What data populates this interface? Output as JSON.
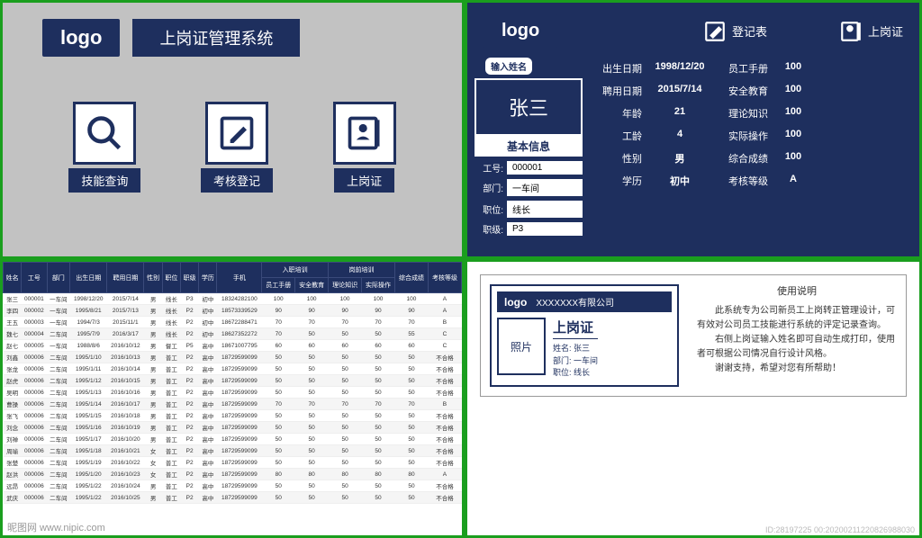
{
  "logo_text": "logo",
  "system_title": "上岗证管理系统",
  "menu": {
    "skill_query": "技能查询",
    "assess_register": "考核登记",
    "cert": "上岗证"
  },
  "detail": {
    "input_name_label": "输入姓名",
    "name": "张三",
    "basic_info": "基本信息",
    "fields": {
      "emp_no_label": "工号:",
      "emp_no": "000001",
      "dept_label": "部门:",
      "dept": "一车间",
      "pos_label": "职位:",
      "pos": "线长",
      "grade_label": "职级:",
      "grade": "P3"
    },
    "tabs": {
      "register": "登记表",
      "cert": "上岗证"
    },
    "info": {
      "birth_label": "出生日期",
      "birth": "1998/12/20",
      "hire_label": "聘用日期",
      "hire": "2015/7/14",
      "age_label": "年龄",
      "age": "21",
      "seniority_label": "工龄",
      "seniority": "4",
      "gender_label": "性别",
      "gender": "男",
      "edu_label": "学历",
      "edu": "初中",
      "handbook_label": "员工手册",
      "handbook": "100",
      "safety_label": "安全教育",
      "safety": "100",
      "theory_label": "理论知识",
      "theory": "100",
      "practice_label": "实际操作",
      "practice": "100",
      "total_label": "综合成绩",
      "total": "100",
      "level_label": "考核等级",
      "level": "A"
    }
  },
  "table": {
    "headers": [
      "姓名",
      "工号",
      "部门",
      "出生日期",
      "聘用日期",
      "性别",
      "职位",
      "职级",
      "学历",
      "手机",
      "员工手册",
      "安全教育",
      "理论知识",
      "实际操作",
      "综合成绩",
      "考核等级"
    ],
    "header_group_left": "入职培训",
    "header_group_right": "岗前培训",
    "rows": [
      [
        "张三",
        "000001",
        "一车间",
        "1998/12/20",
        "2015/7/14",
        "男",
        "线长",
        "P3",
        "初中",
        "18324282100",
        "100",
        "100",
        "100",
        "100",
        "100",
        "A"
      ],
      [
        "李四",
        "000002",
        "一车间",
        "1995/8/21",
        "2015/7/13",
        "男",
        "线长",
        "P2",
        "初中",
        "18573339529",
        "90",
        "90",
        "90",
        "90",
        "90",
        "A"
      ],
      [
        "王五",
        "000003",
        "一车间",
        "1994/7/3",
        "2015/11/1",
        "男",
        "线长",
        "P2",
        "初中",
        "18672288471",
        "70",
        "70",
        "70",
        "70",
        "70",
        "B"
      ],
      [
        "魏七",
        "000004",
        "二车间",
        "1995/7/9",
        "2016/3/17",
        "男",
        "线长",
        "P2",
        "初中",
        "18627352272",
        "70",
        "50",
        "50",
        "50",
        "55",
        "C"
      ],
      [
        "赵七",
        "000005",
        "一车间",
        "1988/8/6",
        "2016/10/12",
        "男",
        "督工",
        "P5",
        "高中",
        "18671007795",
        "60",
        "60",
        "60",
        "60",
        "60",
        "C"
      ],
      [
        "刘鑫",
        "000006",
        "二车间",
        "1995/1/10",
        "2016/10/13",
        "男",
        "普工",
        "P2",
        "高中",
        "18729599099",
        "50",
        "50",
        "50",
        "50",
        "50",
        "不合格"
      ],
      [
        "张龙",
        "000006",
        "二车间",
        "1995/1/11",
        "2016/10/14",
        "男",
        "普工",
        "P2",
        "高中",
        "18729599099",
        "50",
        "50",
        "50",
        "50",
        "50",
        "不合格"
      ],
      [
        "赵虎",
        "000006",
        "二车间",
        "1995/1/12",
        "2016/10/15",
        "男",
        "普工",
        "P2",
        "高中",
        "18729599099",
        "50",
        "50",
        "50",
        "50",
        "50",
        "不合格"
      ],
      [
        "吴明",
        "000006",
        "二车间",
        "1995/1/13",
        "2016/10/16",
        "男",
        "普工",
        "P2",
        "高中",
        "18729599099",
        "50",
        "50",
        "50",
        "50",
        "50",
        "不合格"
      ],
      [
        "曹操",
        "000006",
        "二车间",
        "1995/1/14",
        "2016/10/17",
        "男",
        "普工",
        "P2",
        "高中",
        "18729599099",
        "70",
        "70",
        "70",
        "70",
        "70",
        "B"
      ],
      [
        "张飞",
        "000006",
        "二车间",
        "1995/1/15",
        "2016/10/18",
        "男",
        "普工",
        "P2",
        "高中",
        "18729599099",
        "50",
        "50",
        "50",
        "50",
        "50",
        "不合格"
      ],
      [
        "刘念",
        "000006",
        "二车间",
        "1995/1/16",
        "2016/10/19",
        "男",
        "普工",
        "P2",
        "高中",
        "18729599099",
        "50",
        "50",
        "50",
        "50",
        "50",
        "不合格"
      ],
      [
        "刘禅",
        "000006",
        "二车间",
        "1995/1/17",
        "2016/10/20",
        "男",
        "普工",
        "P2",
        "高中",
        "18729599099",
        "50",
        "50",
        "50",
        "50",
        "50",
        "不合格"
      ],
      [
        "周瑜",
        "000006",
        "二车间",
        "1995/1/18",
        "2016/10/21",
        "女",
        "普工",
        "P2",
        "高中",
        "18729599099",
        "50",
        "50",
        "50",
        "50",
        "50",
        "不合格"
      ],
      [
        "张楚",
        "000006",
        "二车间",
        "1995/1/19",
        "2016/10/22",
        "女",
        "普工",
        "P2",
        "高中",
        "18729599099",
        "50",
        "50",
        "50",
        "50",
        "50",
        "不合格"
      ],
      [
        "赵洪",
        "000006",
        "二车间",
        "1995/1/20",
        "2016/10/23",
        "女",
        "普工",
        "P2",
        "高中",
        "18729599099",
        "80",
        "80",
        "80",
        "80",
        "80",
        "A"
      ],
      [
        "远昂",
        "000006",
        "二车间",
        "1995/1/22",
        "2016/10/24",
        "男",
        "普工",
        "P2",
        "高中",
        "18729599099",
        "50",
        "50",
        "50",
        "50",
        "50",
        "不合格"
      ],
      [
        "武庆",
        "000006",
        "二车间",
        "1995/1/22",
        "2016/10/25",
        "男",
        "普工",
        "P2",
        "高中",
        "18729599099",
        "50",
        "50",
        "50",
        "50",
        "50",
        "不合格"
      ]
    ]
  },
  "card": {
    "company": "XXXXXXX有限公司",
    "photo": "照片",
    "title": "上岗证",
    "name_label": "姓名:",
    "name": "张三",
    "dept_label": "部门:",
    "dept": "一车间",
    "pos_label": "职位:",
    "pos": "线长"
  },
  "instructions": {
    "title": "使用说明",
    "p1": "此系统专为公司新员工上岗转正管理设计，可有效对公司员工技能进行系统的评定记录查询。",
    "p2": "右侧上岗证输入姓名即可自动生成打印，使用者可根据公司情况自行设计风格。",
    "p3": "谢谢支持，希望对您有所帮助！"
  },
  "watermark": "昵图网 www.nipic.com",
  "watermark2": "ID:28197225 00:20200211220826988030"
}
